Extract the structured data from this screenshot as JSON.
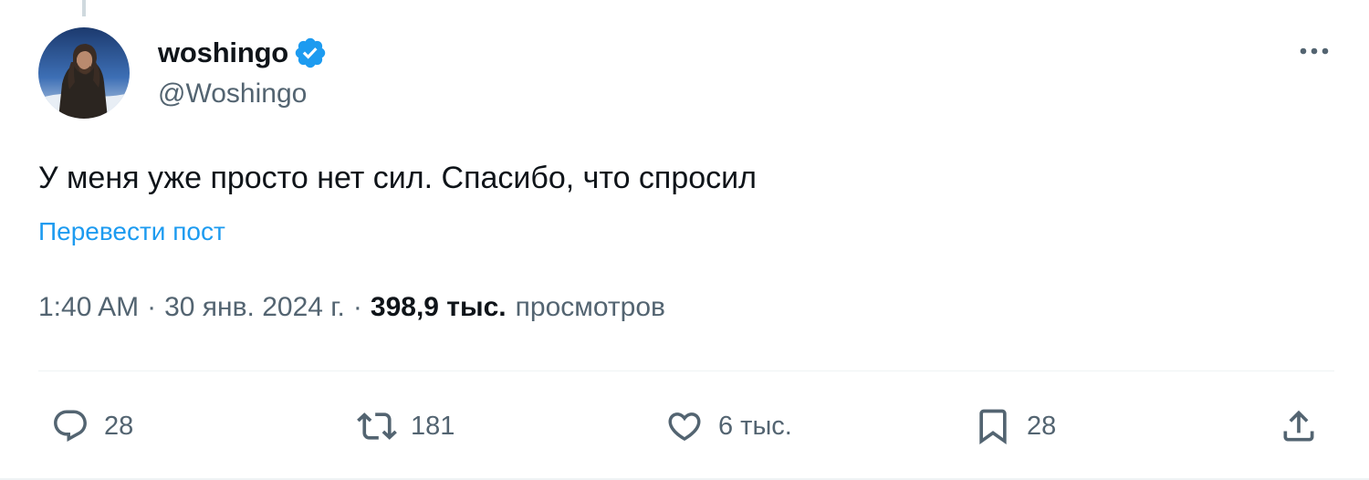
{
  "author": {
    "display_name": "woshingo",
    "handle": "@Woshingo",
    "verified": true
  },
  "tweet": {
    "text": "У меня уже просто нет сил. Спасибо, что спросил",
    "translate_label": "Перевести пост"
  },
  "meta": {
    "time": "1:40 AM",
    "date": "30 янв. 2024 г.",
    "separator": "·",
    "views_count": "398,9 тыс.",
    "views_label": "просмотров"
  },
  "actions": {
    "replies": "28",
    "reposts": "181",
    "likes": "6 тыс.",
    "bookmarks": "28"
  },
  "colors": {
    "accent": "#1d9bf0",
    "secondary_text": "#536471",
    "primary_text": "#0f1419",
    "divider": "#eff3f4"
  },
  "icons": [
    "verified-badge-icon",
    "more-icon",
    "reply-icon",
    "repost-icon",
    "like-icon",
    "bookmark-icon",
    "share-icon"
  ]
}
